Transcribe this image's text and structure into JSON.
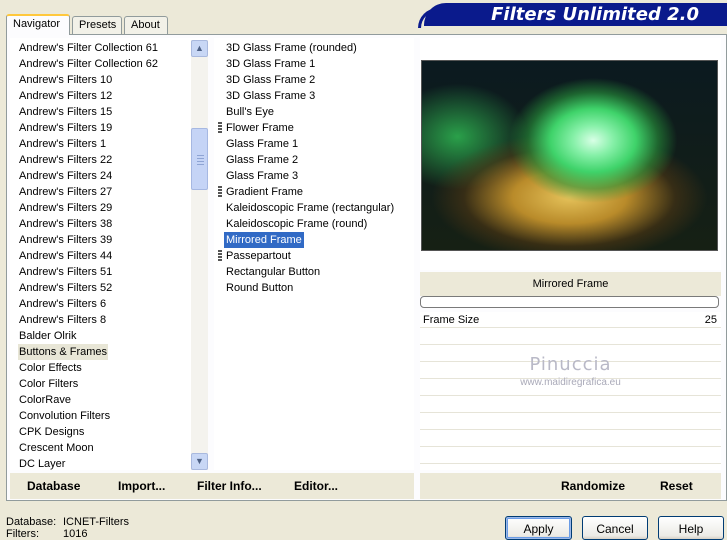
{
  "tabs": [
    {
      "label": "Navigator",
      "active": true
    },
    {
      "label": "Presets",
      "active": false
    },
    {
      "label": "About",
      "active": false
    }
  ],
  "banner": {
    "title": "Filters Unlimited 2.0"
  },
  "categories": {
    "items": [
      "Andrew's Filter Collection 61",
      "Andrew's Filter Collection 62",
      "Andrew's Filters 10",
      "Andrew's Filters 12",
      "Andrew's Filters 15",
      "Andrew's Filters 19",
      "Andrew's Filters 1",
      "Andrew's Filters 22",
      "Andrew's Filters 24",
      "Andrew's Filters 27",
      "Andrew's Filters 29",
      "Andrew's Filters 38",
      "Andrew's Filters 39",
      "Andrew's Filters 44",
      "Andrew's Filters 51",
      "Andrew's Filters 52",
      "Andrew's Filters 6",
      "Andrew's Filters 8",
      "Balder Olrik",
      "Buttons & Frames",
      "Color Effects",
      "Color Filters",
      "ColorRave",
      "Convolution Filters",
      "CPK Designs",
      "Crescent Moon",
      "DC Layer"
    ],
    "selected": "Buttons & Frames"
  },
  "filters": {
    "items": [
      {
        "label": "3D Glass Frame (rounded)",
        "marker": false
      },
      {
        "label": "3D Glass Frame 1",
        "marker": false
      },
      {
        "label": "3D Glass Frame 2",
        "marker": false
      },
      {
        "label": "3D Glass Frame 3",
        "marker": false
      },
      {
        "label": "Bull's Eye",
        "marker": false
      },
      {
        "label": "Flower Frame",
        "marker": true
      },
      {
        "label": "Glass Frame 1",
        "marker": false
      },
      {
        "label": "Glass Frame 2",
        "marker": false
      },
      {
        "label": "Glass Frame 3",
        "marker": false
      },
      {
        "label": "Gradient Frame",
        "marker": true
      },
      {
        "label": "Kaleidoscopic Frame (rectangular)",
        "marker": false
      },
      {
        "label": "Kaleidoscopic Frame (round)",
        "marker": false
      },
      {
        "label": "Mirrored Frame",
        "marker": false
      },
      {
        "label": "Passepartout",
        "marker": true
      },
      {
        "label": "Rectangular Button",
        "marker": false
      },
      {
        "label": "Round Button",
        "marker": false
      }
    ],
    "selected": "Mirrored Frame"
  },
  "preview": {
    "filter_name": "Mirrored Frame",
    "progress": 0
  },
  "parameters": [
    {
      "label": "Frame Size",
      "value": "25"
    }
  ],
  "watermark": {
    "name": "Pinuccia",
    "site": "www.maidiregrafica.eu"
  },
  "toolbar": {
    "database_label": "Database",
    "import_label": "Import...",
    "filter_info_label": "Filter Info...",
    "editor_label": "Editor...",
    "randomize_label": "Randomize",
    "reset_label": "Reset"
  },
  "status": {
    "database_key": "Database:",
    "database_value": "ICNET-Filters",
    "filters_key": "Filters:",
    "filters_value": "1016"
  },
  "dialog": {
    "apply_label": "Apply",
    "cancel_label": "Cancel",
    "help_label": "Help"
  },
  "colors": {
    "selection": "#316ac5",
    "banner": "#0a1a8c",
    "window_bg": "#ece9d8"
  }
}
